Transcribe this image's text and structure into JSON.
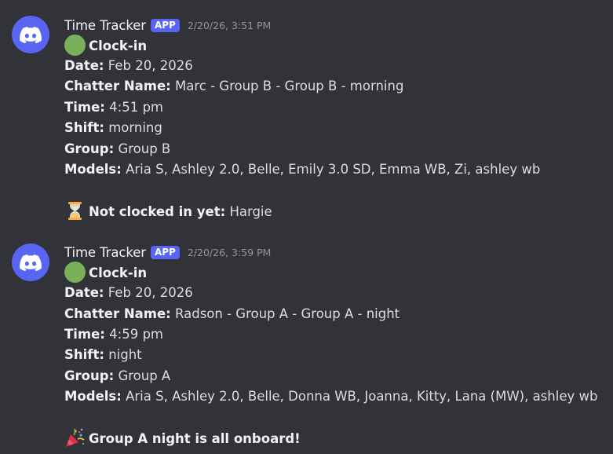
{
  "messages": [
    {
      "username": "Time Tracker",
      "badge": "APP",
      "timestamp": "2/20/26, 3:51 PM",
      "title": "Clock-in",
      "title_icon": "green-circle-icon",
      "fields": [
        {
          "label": "Date:",
          "value": "Feb 20, 2026"
        },
        {
          "label": "Chatter Name:",
          "value": "Marc - Group B - Group B - morning"
        },
        {
          "label": "Time:",
          "value": "4:51 pm"
        },
        {
          "label": "Shift:",
          "value": "morning"
        },
        {
          "label": "Group:",
          "value": "Group B"
        },
        {
          "label": "Models:",
          "value": "Aria S, Ashley 2.0, Belle, Emily 3.0 SD, Emma WB, Zi, ashley wb"
        }
      ],
      "footer_icon": "hourglass-icon",
      "footer_label": "Not clocked in yet:",
      "footer_value": "Hargie"
    },
    {
      "username": "Time Tracker",
      "badge": "APP",
      "timestamp": "2/20/26, 3:59 PM",
      "title": "Clock-in",
      "title_icon": "green-circle-icon",
      "fields": [
        {
          "label": "Date:",
          "value": "Feb 20, 2026"
        },
        {
          "label": "Chatter Name:",
          "value": "Radson - Group A - Group A - night"
        },
        {
          "label": "Time:",
          "value": "4:59 pm"
        },
        {
          "label": "Shift:",
          "value": "night"
        },
        {
          "label": "Group:",
          "value": "Group A"
        },
        {
          "label": "Models:",
          "value": "Aria S, Ashley 2.0, Belle, Donna WB, Joanna, Kitty, Lana (MW), ashley wb"
        }
      ],
      "footer_icon": "party-popper-icon",
      "footer_label": "Group A night is all onboard!",
      "footer_value": ""
    }
  ],
  "colors": {
    "background": "#323339",
    "avatar": "#5865f2",
    "badge": "#5865f2",
    "username": "#f2f3f5",
    "timestamp": "#94959c",
    "text": "#dbdee1",
    "green_circle": "#78b159"
  }
}
